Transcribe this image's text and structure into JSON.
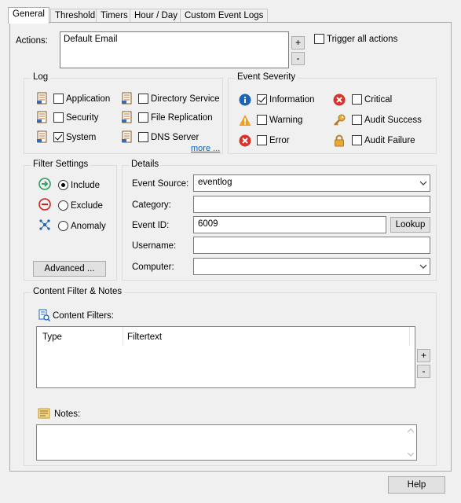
{
  "tabs": [
    "General",
    "Threshold",
    "Timers",
    "Hour / Day",
    "Custom Event Logs"
  ],
  "actions": {
    "label": "Actions:",
    "list_items": [
      "Default Email"
    ],
    "add_label": "+",
    "remove_label": "-",
    "trigger_all_label": "Trigger all actions",
    "trigger_all_checked": false
  },
  "log": {
    "title": "Log",
    "items": [
      {
        "label": "Application",
        "checked": false
      },
      {
        "label": "Security",
        "checked": false
      },
      {
        "label": "System",
        "checked": true
      },
      {
        "label": "Directory Service",
        "checked": false
      },
      {
        "label": "File Replication",
        "checked": false
      },
      {
        "label": "DNS Server",
        "checked": false
      }
    ],
    "more_label": "more ..."
  },
  "severity": {
    "title": "Event Severity",
    "items": [
      {
        "label": "Information",
        "checked": true,
        "icon": "info-icon"
      },
      {
        "label": "Warning",
        "checked": false,
        "icon": "warning-icon"
      },
      {
        "label": "Error",
        "checked": false,
        "icon": "error-icon"
      },
      {
        "label": "Critical",
        "checked": false,
        "icon": "critical-icon"
      },
      {
        "label": "Audit Success",
        "checked": false,
        "icon": "key-icon"
      },
      {
        "label": "Audit Failure",
        "checked": false,
        "icon": "lock-icon"
      }
    ]
  },
  "filter": {
    "title": "Filter Settings",
    "options": [
      {
        "label": "Include",
        "selected": true,
        "icon": "include-arrow-icon"
      },
      {
        "label": "Exclude",
        "selected": false,
        "icon": "exclude-minus-icon"
      },
      {
        "label": "Anomaly",
        "selected": false,
        "icon": "anomaly-network-icon"
      }
    ],
    "advanced_label": "Advanced ..."
  },
  "details": {
    "title": "Details",
    "event_source_label": "Event Source:",
    "event_source_value": "eventlog",
    "category_label": "Category:",
    "category_value": "",
    "event_id_label": "Event ID:",
    "event_id_value": "6009",
    "lookup_label": "Lookup",
    "username_label": "Username:",
    "username_value": "",
    "computer_label": "Computer:",
    "computer_value": ""
  },
  "content": {
    "title": "Content Filter & Notes",
    "filters_label": "Content Filters:",
    "columns": [
      "Type",
      "Filtertext"
    ],
    "add_label": "+",
    "remove_label": "-",
    "notes_label": "Notes:",
    "notes_value": ""
  },
  "help_label": "Help",
  "colors": {
    "info": "#1e64b4",
    "warning": "#f0a020",
    "error": "#d9342b",
    "include": "#2a9d5c",
    "exclude": "#cc2222",
    "link": "#0066cc"
  }
}
